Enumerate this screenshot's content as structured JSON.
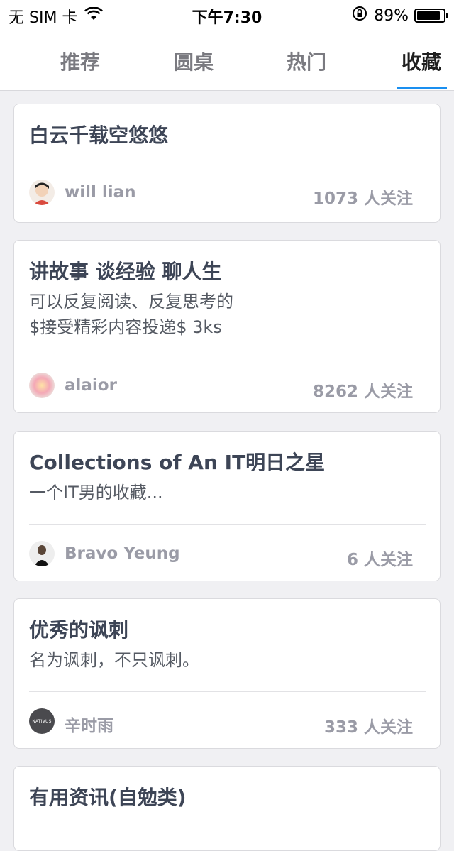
{
  "status_bar": {
    "carrier": "无 SIM 卡",
    "time": "下午7:30",
    "battery_percent": "89%",
    "battery_level": 0.89
  },
  "tabs": [
    {
      "label": "推荐",
      "active": false
    },
    {
      "label": "圆桌",
      "active": false
    },
    {
      "label": "热门",
      "active": false
    },
    {
      "label": "收藏",
      "active": true
    }
  ],
  "collections": [
    {
      "title": "白云千载空悠悠",
      "description": "",
      "author": "will lian",
      "followers": "1073 人关注"
    },
    {
      "title": "讲故事 谈经验 聊人生",
      "description_line1": "可以反复阅读、反复思考的",
      "description_line2": "$接受精彩内容投递$ 3ks",
      "author": "alaior",
      "followers": "8262 人关注"
    },
    {
      "title": "Collections of An IT明日之星",
      "description": "一个IT男的收藏...",
      "author": "Bravo Yeung",
      "followers": "6 人关注"
    },
    {
      "title": "优秀的讽刺",
      "description": "名为讽刺，不只讽刺。",
      "author": "辛时雨",
      "followers": "333 人关注",
      "avatar_text": "NATIVUS"
    },
    {
      "title": "有用资讯(自勉类)"
    }
  ],
  "colors": {
    "accent": "#1a8ff0",
    "background": "#f0f0f3",
    "title": "#3d4556",
    "muted": "#9a9ba6"
  }
}
